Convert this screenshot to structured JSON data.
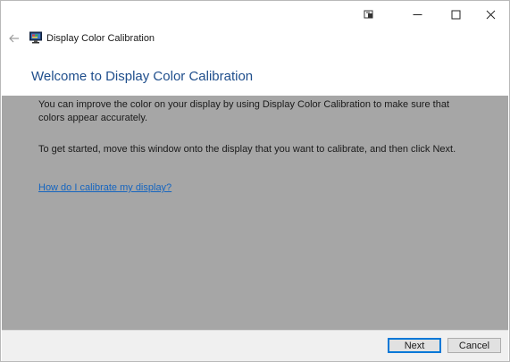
{
  "window": {
    "app_title": "Display Color Calibration"
  },
  "titlebar": {
    "buttons": [
      "pin-icon",
      "minimize-icon",
      "maximize-icon",
      "close-icon"
    ]
  },
  "page": {
    "heading": "Welcome to Display Color Calibration",
    "paragraph1": "You can improve the color on your display by using Display Color Calibration to make sure that colors appear accurately.",
    "paragraph2": "To get started, move this window onto the display that you want to calibrate, and then click Next.",
    "help_link": "How do I calibrate my display?"
  },
  "footer": {
    "next_label": "Next",
    "cancel_label": "Cancel"
  },
  "colors": {
    "heading": "#1f4e8c",
    "content_background": "#a6a6a6",
    "link": "#1565c0",
    "accent": "#0078d7"
  }
}
